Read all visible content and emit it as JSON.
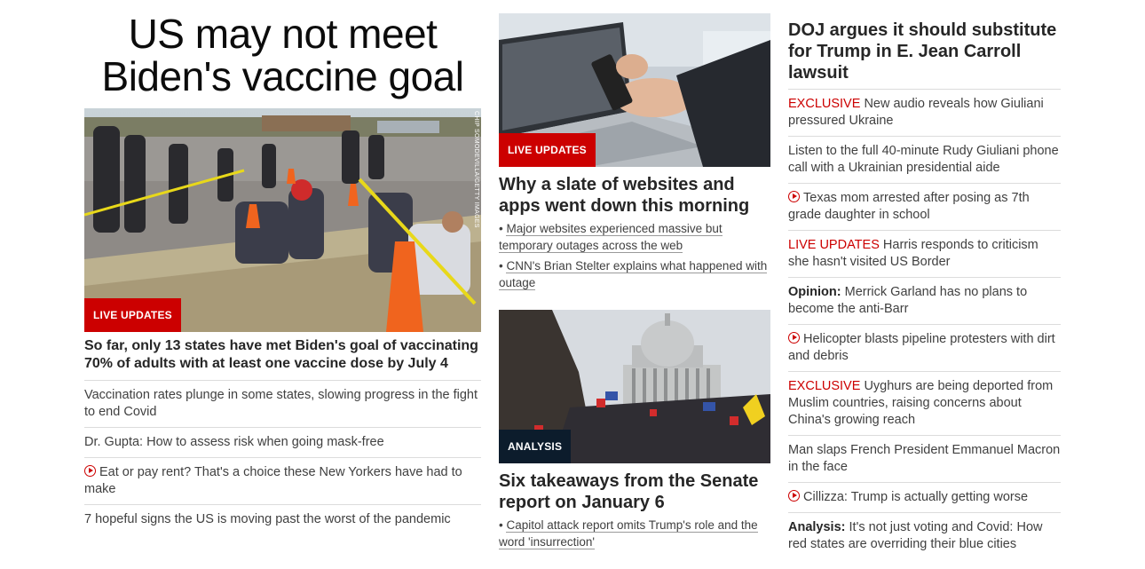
{
  "main_story": {
    "title": "US may not meet Biden's vaccine goal",
    "image_credit": "CHIP SOMODEVILLA/GETTY IMAGES",
    "badge": "LIVE UPDATES",
    "headline": "So far, only 13 states have met Biden's goal of vaccinating 70% of adults with at least one vaccine dose by July 4",
    "related": [
      {
        "text": "Vaccination rates plunge in some states, slowing progress in the fight to end Covid",
        "video": false
      },
      {
        "text": "Dr. Gupta: How to assess risk when going mask-free",
        "video": false
      },
      {
        "text": "Eat or pay rent? That's a choice these New Yorkers have had to make",
        "video": true
      },
      {
        "text": "7 hopeful signs the US is moving past the worst of the pandemic",
        "video": false
      }
    ]
  },
  "card_outage": {
    "badge": "LIVE UPDATES",
    "headline": "Why a slate of websites and apps went down this morning",
    "bullets": [
      "Major websites experienced massive but temporary outages across the web",
      "CNN's Brian Stelter explains what happened with outage"
    ]
  },
  "card_senate": {
    "badge": "ANALYSIS",
    "headline": "Six takeaways from the Senate report on January 6",
    "bullets": [
      "Capitol attack report omits Trump's role and the word 'insurrection'"
    ]
  },
  "sidebar": {
    "title": "DOJ argues it should substitute for Trump in E. Jean Carroll lawsuit",
    "items": [
      {
        "kicker": "EXCLUSIVE",
        "kicker_style": "red",
        "text": "New audio reveals how Giuliani pressured Ukraine",
        "video": false
      },
      {
        "kicker": "",
        "kicker_style": "",
        "text": "Listen to the full 40-minute Rudy Giuliani phone call with a Ukrainian presidential aide",
        "video": false
      },
      {
        "kicker": "",
        "kicker_style": "",
        "text": "Texas mom arrested after posing as 7th grade daughter in school",
        "video": true
      },
      {
        "kicker": "LIVE UPDATES",
        "kicker_style": "red",
        "text": "Harris responds to criticism she hasn't visited US Border",
        "video": false
      },
      {
        "kicker": "Opinion:",
        "kicker_style": "bold",
        "text": "Merrick Garland has no plans to become the anti-Barr",
        "video": false
      },
      {
        "kicker": "",
        "kicker_style": "",
        "text": "Helicopter blasts pipeline protesters with dirt and debris",
        "video": true
      },
      {
        "kicker": "EXCLUSIVE",
        "kicker_style": "red",
        "text": "Uyghurs are being deported from Muslim countries, raising concerns about China's growing reach",
        "video": false
      },
      {
        "kicker": "",
        "kicker_style": "",
        "text": "Man slaps French President Emmanuel Macron in the face",
        "video": false
      },
      {
        "kicker": "",
        "kicker_style": "",
        "text": "Cillizza: Trump is actually getting worse",
        "video": true
      },
      {
        "kicker": "Analysis:",
        "kicker_style": "bold",
        "text": "It's not just voting and Covid: How red states are overriding their blue cities",
        "video": false
      }
    ]
  },
  "colors": {
    "accent_red": "#cc0000",
    "analysis_navy": "#0c1c2c",
    "divider": "#dcdcdc"
  }
}
